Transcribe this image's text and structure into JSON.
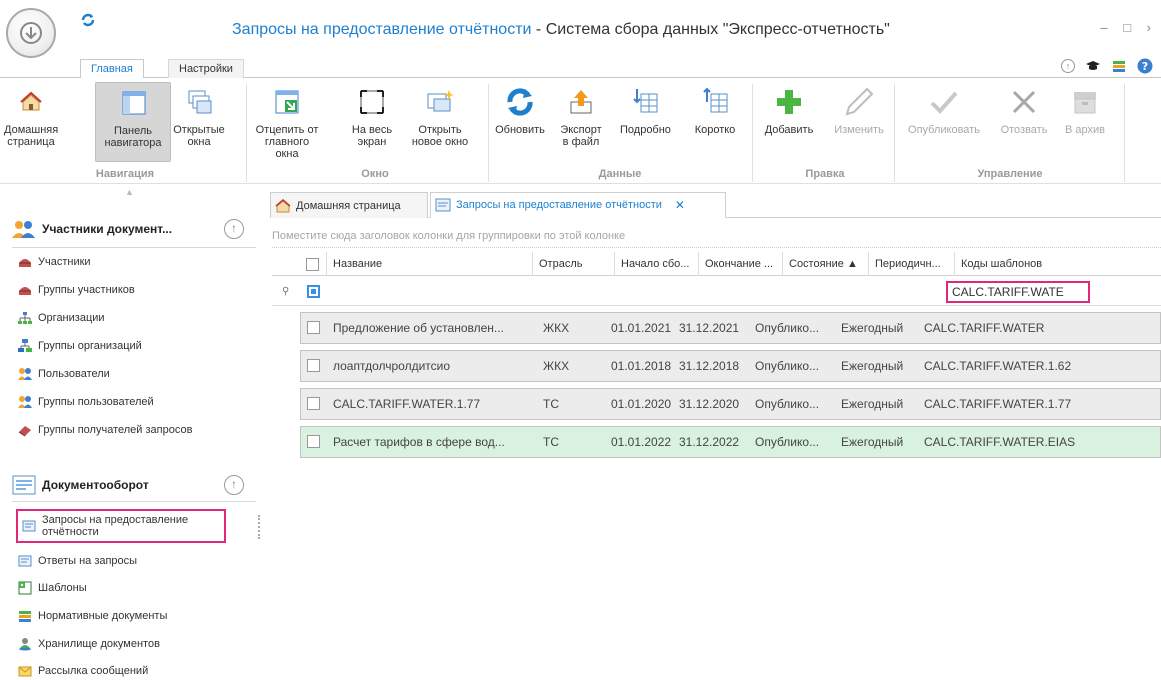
{
  "window": {
    "title_accent": "Запросы на предоставление отчётности",
    "title_rest": " - Система сбора данных \"Экспресс-отчетность\"",
    "controls": "– □ ›"
  },
  "ribbon_tabs": [
    {
      "label": "Главная"
    },
    {
      "label": "Настройки"
    }
  ],
  "ribbon": {
    "buttons": {
      "home": "Домашняя страница",
      "nav_panel": "Панель навигатора",
      "open_windows": "Открытые окна",
      "undock": "Отцепить от главного окна",
      "fullscreen": "На весь экран",
      "new_window": "Открыть новое окно",
      "refresh": "Обновить",
      "export": "Экспорт в файл",
      "detailed": "Подробно",
      "brief": "Коротко",
      "add": "Добавить",
      "edit": "Изменить",
      "publish": "Опубликовать",
      "revoke": "Отозвать",
      "archive": "В архив"
    },
    "groups": {
      "navigation": "Навигация",
      "window": "Окно",
      "data": "Данные",
      "edit": "Правка",
      "manage": "Управление"
    }
  },
  "sidebar": {
    "section1": {
      "title": "Участники документ..."
    },
    "items1": [
      {
        "label": "Участники"
      },
      {
        "label": "Группы участников"
      },
      {
        "label": "Организации"
      },
      {
        "label": "Группы организаций"
      },
      {
        "label": "Пользователи"
      },
      {
        "label": "Группы пользователей"
      },
      {
        "label": "Группы получателей запросов"
      }
    ],
    "section2": {
      "title": "Документооборот"
    },
    "items2": [
      {
        "label": "Запросы на предоставление отчётности"
      },
      {
        "label": "Ответы на запросы"
      },
      {
        "label": "Шаблоны"
      },
      {
        "label": "Нормативные документы"
      },
      {
        "label": "Хранилище документов"
      },
      {
        "label": "Рассылка сообщений"
      }
    ]
  },
  "doc_tabs": [
    {
      "label": "Домашняя страница"
    },
    {
      "label": "Запросы на предоставление отчётности"
    }
  ],
  "grid": {
    "group_hint": "Поместите сюда заголовок колонки для группировки по этой колонке",
    "columns": [
      {
        "label": "Название"
      },
      {
        "label": "Отрасль"
      },
      {
        "label": "Начало сбо..."
      },
      {
        "label": "Окончание ..."
      },
      {
        "label": "Состояние ▲"
      },
      {
        "label": "Периодичн..."
      },
      {
        "label": "Коды шаблонов"
      }
    ],
    "filter_value": "CALC.TARIFF.WATE",
    "rows": [
      {
        "name": "Предложение об установлен...",
        "industry": "ЖКХ",
        "start": "01.01.2021",
        "end": "31.12.2021",
        "state": "Опублико...",
        "period": "Ежегодный",
        "codes": "CALC.TARIFF.WATER"
      },
      {
        "name": "лоаптдолчролдитсио",
        "industry": "ЖКХ",
        "start": "01.01.2018",
        "end": "31.12.2018",
        "state": "Опублико...",
        "period": "Ежегодный",
        "codes": "CALC.TARIFF.WATER.1.62"
      },
      {
        "name": "CALC.TARIFF.WATER.1.77",
        "industry": "ТС",
        "start": "01.01.2020",
        "end": "31.12.2020",
        "state": "Опублико...",
        "period": "Ежегодный",
        "codes": "CALC.TARIFF.WATER.1.77"
      },
      {
        "name": "Расчет тарифов в сфере вод...",
        "industry": "ТС",
        "start": "01.01.2022",
        "end": "31.12.2022",
        "state": "Опублико...",
        "period": "Ежегодный",
        "codes": "CALC.TARIFF.WATER.EIAS"
      }
    ]
  },
  "colors": {
    "accent": "#1e7fcf",
    "highlight": "#e0287a",
    "row_gray": "#ececec",
    "row_green": "#d9f2df"
  }
}
